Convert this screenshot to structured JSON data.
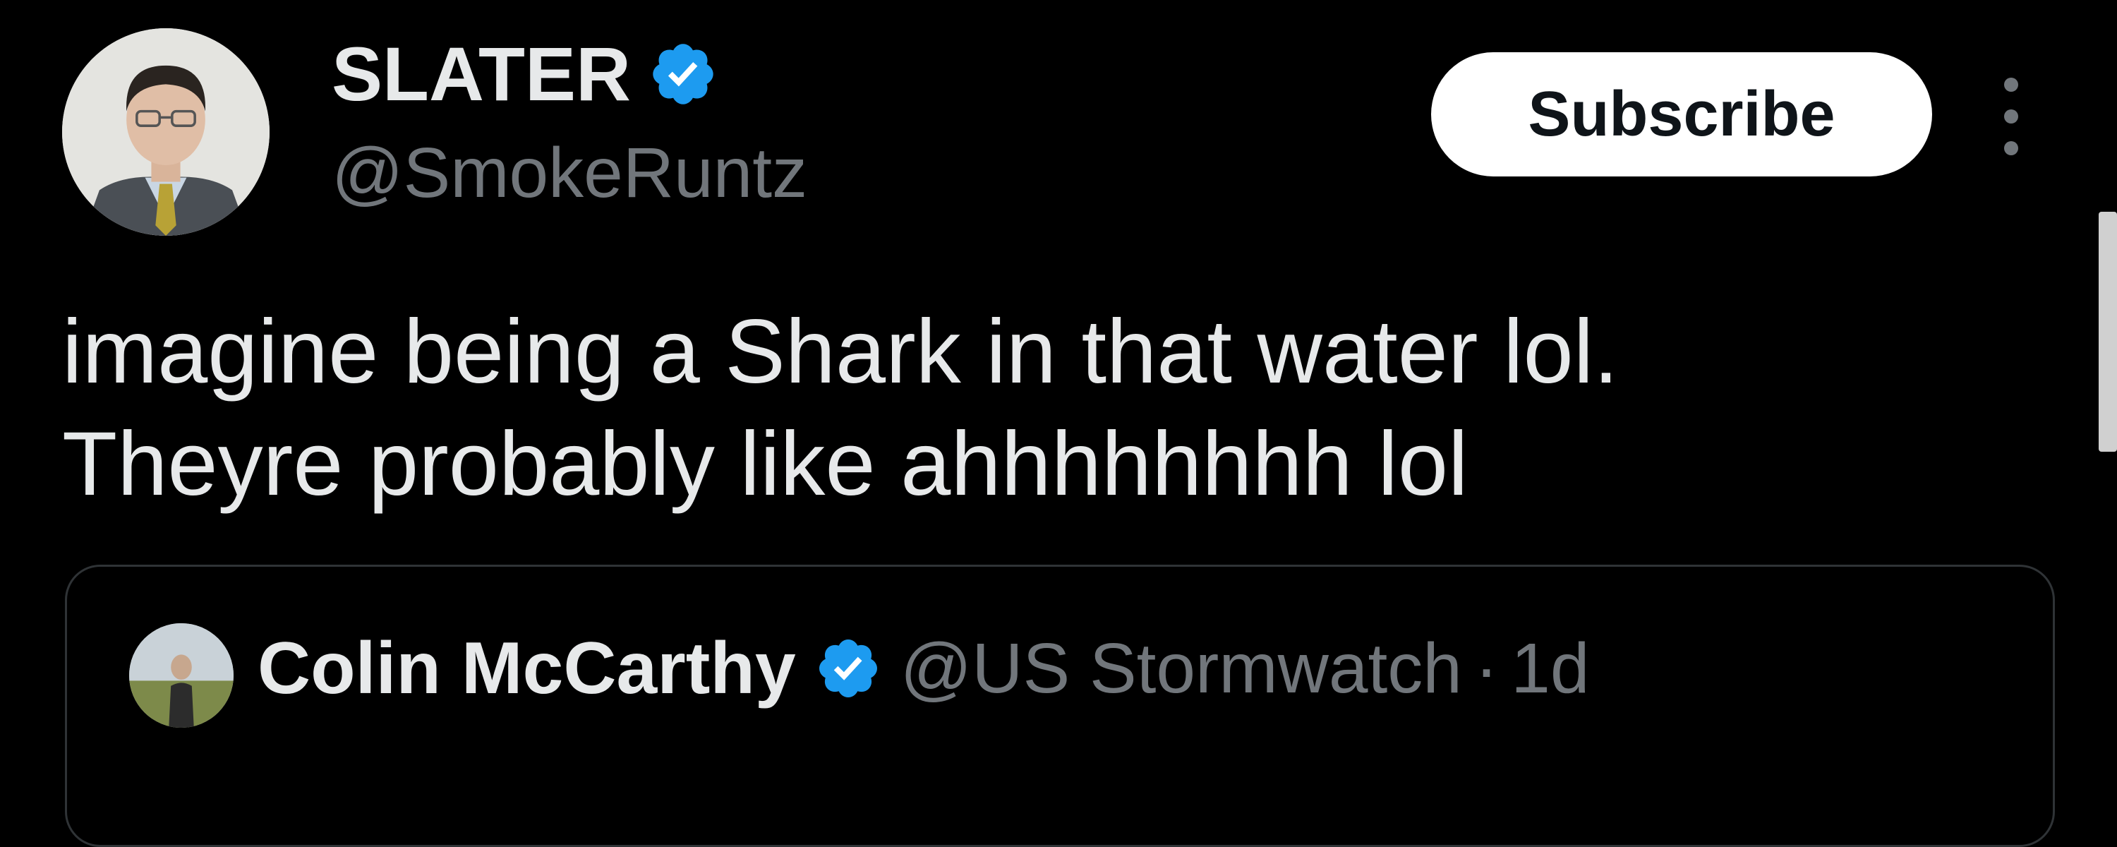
{
  "tweet": {
    "author": {
      "name": "SLATER",
      "handle": "@SmokeRuntz",
      "verified_icon": "verified-badge-icon"
    },
    "subscribe_label": "Subscribe",
    "more_icon": "more-vertical-icon",
    "text_lines": [
      "imagine being a Shark in that water lol.",
      "Theyre probably like ahhhhhhhh lol"
    ]
  },
  "quoted_tweet": {
    "author": {
      "name": "Colin McCarthy",
      "handle": "@US Stormwatch",
      "verified_icon": "verified-badge-icon"
    },
    "separator": "·",
    "time": "1d"
  },
  "colors": {
    "background": "#000000",
    "primary_text": "#e7e9ea",
    "secondary_text": "#71767b",
    "verified_blue": "#1d9bf0",
    "button_bg": "#ffffff",
    "button_text": "#0f1419",
    "border": "#2f3336"
  }
}
